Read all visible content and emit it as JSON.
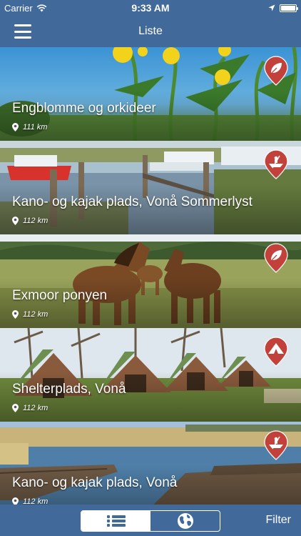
{
  "status": {
    "carrier": "Carrier",
    "time": "9:33 AM"
  },
  "nav": {
    "title": "Liste"
  },
  "items": [
    {
      "title": "Engblomme og orkideer",
      "distance": "111 km",
      "icon": "leaf-icon"
    },
    {
      "title": "Kano- og kajak plads, Vonå Sommerlyst",
      "distance": "112 km",
      "icon": "boat-icon"
    },
    {
      "title": "Exmoor ponyen",
      "distance": "112 km",
      "icon": "leaf-icon"
    },
    {
      "title": "Shelterplads, Vonå",
      "distance": "112 km",
      "icon": "tent-icon"
    },
    {
      "title": "Kano- og kajak plads, Vonå",
      "distance": "112 km",
      "icon": "boat-icon"
    }
  ],
  "bottom": {
    "filter_label": "Filter",
    "active_view": "list"
  },
  "colors": {
    "bar": "#41699a",
    "pin": "#c2413a"
  }
}
